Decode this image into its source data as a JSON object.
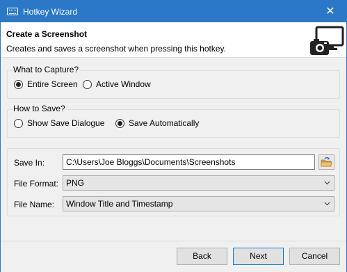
{
  "window": {
    "title": "Hotkey Wizard",
    "close_glyph": "✕"
  },
  "header": {
    "title": "Create a Screenshot",
    "subtitle": "Creates and saves a screenshot when pressing this hotkey.",
    "icon": "screenshot-camera-icon"
  },
  "capture": {
    "legend": "What to Capture?",
    "options": [
      {
        "label": "Entire Screen",
        "checked": true
      },
      {
        "label": "Active Window",
        "checked": false
      }
    ]
  },
  "save": {
    "legend": "How to Save?",
    "options": [
      {
        "label": "Show Save Dialogue",
        "checked": false
      },
      {
        "label": "Save Automatically",
        "checked": true
      }
    ]
  },
  "settings": {
    "save_in_label": "Save In:",
    "save_in_value": "C:\\Users\\Joe Bloggs\\Documents\\Screenshots",
    "browse_icon": "folder-browse-icon",
    "file_format_label": "File Format:",
    "file_format_value": "PNG",
    "file_name_label": "File Name:",
    "file_name_value": "Window Title and Timestamp"
  },
  "footer": {
    "back_label": "Back",
    "next_label": "Next",
    "cancel_label": "Cancel"
  },
  "colors": {
    "titlebar": "#2b78c8",
    "accent": "#0078d7"
  }
}
